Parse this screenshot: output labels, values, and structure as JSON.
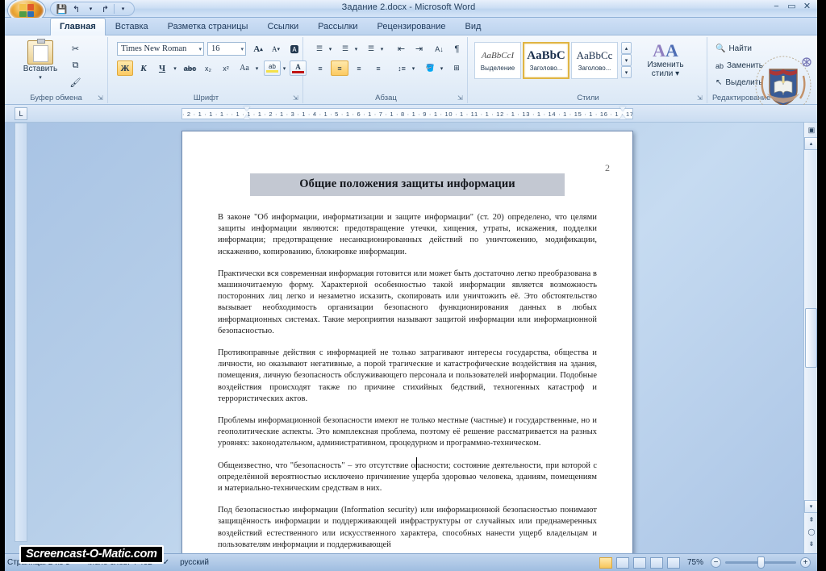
{
  "window": {
    "title": "Задание 2.docx - Microsoft Word",
    "minimize": "−",
    "maximize": "▭",
    "close": "✕"
  },
  "quick_access": {
    "save": "💾",
    "undo": "↰",
    "redo": "↱",
    "customize": "▾"
  },
  "tabs": [
    {
      "label": "Главная",
      "active": true
    },
    {
      "label": "Вставка",
      "active": false
    },
    {
      "label": "Разметка страницы",
      "active": false
    },
    {
      "label": "Ссылки",
      "active": false
    },
    {
      "label": "Рассылки",
      "active": false
    },
    {
      "label": "Рецензирование",
      "active": false
    },
    {
      "label": "Вид",
      "active": false
    }
  ],
  "ribbon": {
    "clipboard": {
      "label": "Буфер обмена",
      "paste_label": "Вставить",
      "paste_arrow": "▾",
      "cut": "✂",
      "copy": "⧉",
      "format_painter": "🖌",
      "dialog_launcher": "⇲"
    },
    "font": {
      "label": "Шрифт",
      "font_name": "Times New Roman",
      "font_size": "16",
      "grow_font": "A",
      "shrink_font": "A",
      "clear_formatting": "🅰",
      "bold": "Ж",
      "italic": "К",
      "underline": "Ч",
      "underline_arrow": "▾",
      "strikethrough": "abc",
      "subscript": "x₂",
      "superscript": "x²",
      "change_case": "Aa",
      "change_case_arrow": "▾",
      "highlight": "ab",
      "highlight_arrow": "▾",
      "font_color": "A",
      "font_color_arrow": "▾",
      "dialog_launcher": "⇲"
    },
    "paragraph": {
      "label": "Абзац",
      "bullets": "☰",
      "bullets_arrow": "▾",
      "numbering": "☰",
      "numbering_arrow": "▾",
      "multilevel": "☰",
      "multilevel_arrow": "▾",
      "decrease_indent": "⇤",
      "increase_indent": "⇥",
      "sort": "A↓",
      "show_marks": "¶",
      "align_left": "≡",
      "align_center": "≡",
      "align_right": "≡",
      "align_justify": "≡",
      "line_spacing": "↕≡",
      "line_spacing_arrow": "▾",
      "shading": "🪣",
      "shading_arrow": "▾",
      "borders": "⊞",
      "borders_arrow": "▾",
      "dialog_launcher": "⇲"
    },
    "styles": {
      "label": "Стили",
      "gallery": [
        {
          "preview": "AaBbCcI",
          "name": "Выделение",
          "selected": false
        },
        {
          "preview": "AaBbC",
          "name": "Заголово...",
          "selected": true
        },
        {
          "preview": "AaBbCc",
          "name": "Заголово...",
          "selected": false
        }
      ],
      "scroll_up": "▴",
      "scroll_down": "▾",
      "more": "▾",
      "change_styles_label": "Изменить\nстили",
      "change_styles_line1": "Изменить",
      "change_styles_line2": "стили ▾",
      "dialog_launcher": "⇲"
    },
    "editing": {
      "label": "Редактирование",
      "find": "Найти",
      "find_icon": "🔍",
      "replace": "Заменить",
      "replace_icon": "ab",
      "select": "Выделить",
      "select_icon": "↖"
    }
  },
  "ruler": {
    "tab_selector": "L",
    "horizontal_marks": "3 · 1 · 2 · 1 · 1 · 1 ·  · 1 · 1 · 1 · 2 · 1 · 3 · 1 · 4 · 1 · 5 · 1 · 6 · 1 · 7 · 1 · 8 · 1 · 9 · 1 · 10 · 1 · 11 · 1 · 12 · 1 · 13 · 1 · 14 · 1 · 15 · 1 · 16 · 1 · 17 · 1 ·"
  },
  "document": {
    "page_number": "2",
    "heading": "Общие положения защиты информации",
    "paragraphs": [
      "В законе \"Об информации, информатизации и защите информации\" (ст. 20) определено, что целями защиты информации являются: предотвращение утечки, хищения, утраты, искажения, подделки информации; предотвращение несанкционированных действий по уничтожению, модификации, искажению, копированию, блокировке информации.",
      "Практически вся современная информация готовится или может быть достаточно легко преобразована в машиночитаемую форму. Характерной особенностью такой информации является возможность посторонних лиц легко и незаметно исказить, скопировать или уничтожить её. Это обстоятельство вызывает необходимость организации безопасного функционирования данных в любых информационных системах. Такие мероприятия называют защитой информации или информационной безопасностью.",
      "Противоправные действия с информацией не только затрагивают интересы государства, общества и личности, но оказывают негативные, а порой трагические и катастрофические воздействия на здания, помещения, личную безопасность обслуживающего персонала и пользователей информации. Подобные воздействия происходят также по причине стихийных бедствий, техногенных катастроф и террористических актов.",
      "Проблемы информационной безопасности имеют не только местные (частные) и государственные, но и геополитические аспекты. Это комплексная проблема, поэтому её решение рассматривается на разных уровнях: законодательном, административном, процедурном и программно-техническом.",
      "Общеизвестно, что \"безопасность\" – это отсутствие опасности; состояние деятельности, при которой с определённой вероятностью исключено причинение ущерба здоровью человека, зданиям, помещениям и материально-техническим средствам в них.",
      "Под безопасностью информации (Information security) или информационной безопасностью понимают защищённость информации и поддерживающей инфраструктуры от случайных или преднамеренных воздействий естественного или искусственного характера, способных нанести ущерб владельцам и пользователям информации и поддерживающей"
    ]
  },
  "scrollbar": {
    "up_arrow": "▴",
    "down_arrow": "▾",
    "split": "▬",
    "select_browse_object": "◯",
    "previous_page": "⇞",
    "next_page": "⇟"
  },
  "status_bar": {
    "page": "Страница: 2 из 5",
    "words": "Число слов: 4 462",
    "proofing_icon": "✓",
    "language": "русский",
    "zoom_level": "75%",
    "zoom_out": "−",
    "zoom_in": "+"
  },
  "watermarks": {
    "screencast": "Screencast-O-Matic.com"
  }
}
